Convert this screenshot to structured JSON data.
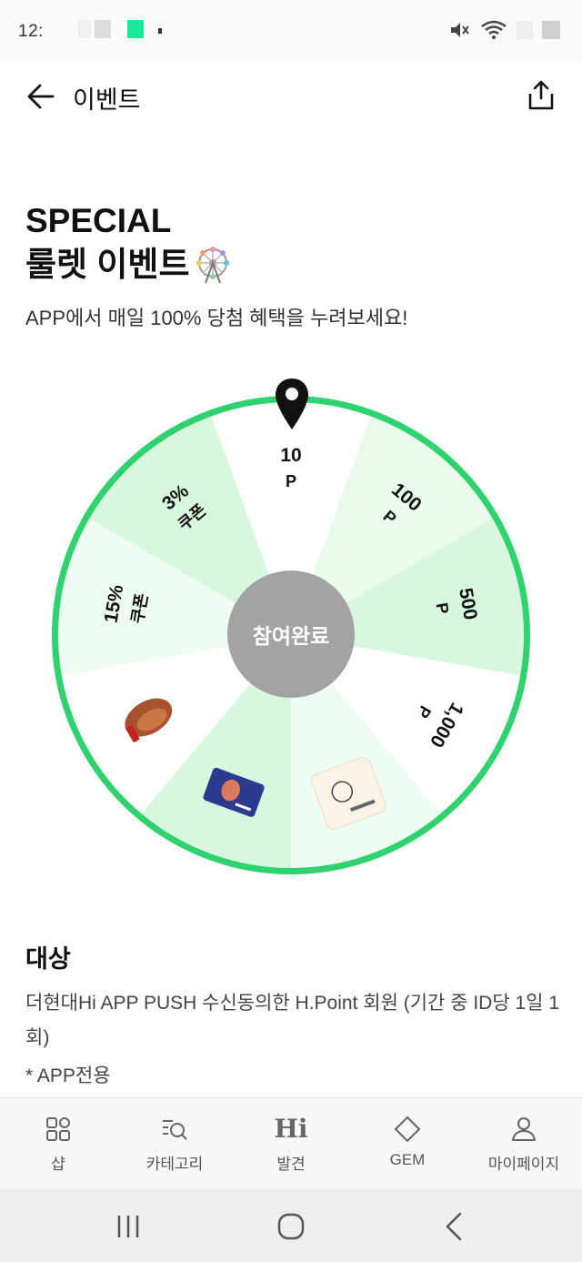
{
  "status_bar": {
    "time": "12:",
    "icons": [
      "mute-icon",
      "wifi-icon",
      "battery-icon"
    ]
  },
  "header": {
    "title": "이벤트",
    "back_icon": "arrow-left-icon",
    "share_icon": "share-icon"
  },
  "event": {
    "title_line1": "SPECIAL",
    "title_line2": "룰렛 이벤트",
    "title_emoji": "ferris-wheel-icon",
    "subtitle": "APP에서 매일 100% 당첨 혜택을 누려보세요!"
  },
  "wheel": {
    "center_label": "참여완료",
    "pointer_icon": "location-pin-icon",
    "segments": [
      {
        "amount": "10",
        "unit": "P",
        "color": "#ffffff"
      },
      {
        "amount": "100",
        "unit": "P",
        "color": "#e8fbec"
      },
      {
        "amount": "500",
        "unit": "P",
        "color": "#d8f7df"
      },
      {
        "amount": "1,000",
        "unit": "P",
        "color": "#ffffff"
      },
      {
        "image": "voucher-card-icon",
        "color": "#eefcf1"
      },
      {
        "image": "blue-card-icon",
        "color": "#d8f7df"
      },
      {
        "image": "nuts-snack-icon",
        "color": "#ffffff"
      },
      {
        "amount": "15%",
        "unit": "쿠폰",
        "color": "#eefcf1"
      },
      {
        "amount": "3%",
        "unit": "쿠폰",
        "color": "#d8f7df"
      }
    ],
    "ring_color": "#2fd26e"
  },
  "target": {
    "title": "대상",
    "body": "더현대Hi APP PUSH 수신동의한 H.Point 회원 (기간 중 ID당 1일 1회)",
    "note": "* APP전용"
  },
  "tabbar": {
    "items": [
      {
        "label": "샵",
        "icon": "grid-icon"
      },
      {
        "label": "카테고리",
        "icon": "category-search-icon"
      },
      {
        "label": "발견",
        "icon": "hi-logo-icon",
        "glyph": "Hi"
      },
      {
        "label": "GEM",
        "icon": "diamond-icon"
      },
      {
        "label": "마이페이지",
        "icon": "person-icon"
      }
    ]
  },
  "navbar": {
    "icons": [
      "recent-apps-icon",
      "home-icon",
      "back-icon"
    ]
  }
}
